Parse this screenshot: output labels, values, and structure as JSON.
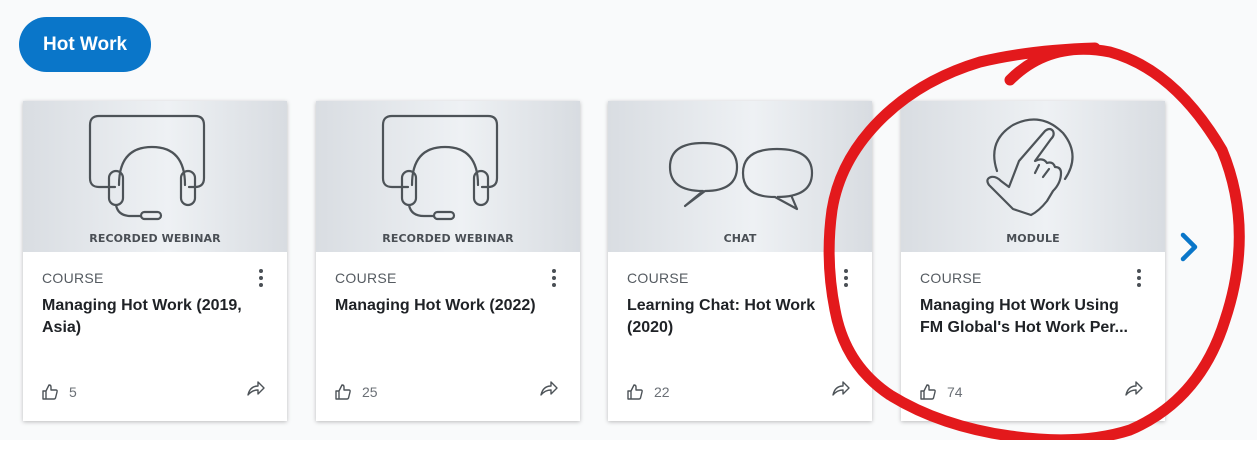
{
  "header": {
    "tag_label": "Hot Work"
  },
  "cards": [
    {
      "thumb_label": "RECORDED WEBINAR",
      "thumb_icon": "headset-monitor-icon",
      "type": "COURSE",
      "title": "Managing Hot Work (2019, Asia)",
      "likes": "5"
    },
    {
      "thumb_label": "RECORDED WEBINAR",
      "thumb_icon": "headset-monitor-icon",
      "type": "COURSE",
      "title": "Managing Hot Work (2022)",
      "likes": "25"
    },
    {
      "thumb_label": "CHAT",
      "thumb_icon": "chat-bubbles-icon",
      "type": "COURSE",
      "title": "Learning Chat: Hot Work (2020)",
      "likes": "22"
    },
    {
      "thumb_label": "MODULE",
      "thumb_icon": "touch-hand-icon",
      "type": "COURSE",
      "title": "Managing Hot Work Using FM Global's Hot Work Per...",
      "likes": "74"
    }
  ],
  "colors": {
    "accent": "#0a76c9",
    "annotation": "#e3191c"
  },
  "icons": {
    "like": "thumbs-up-icon",
    "share": "share-arrow-icon",
    "menu": "kebab-menu-icon",
    "next": "chevron-right-icon"
  }
}
